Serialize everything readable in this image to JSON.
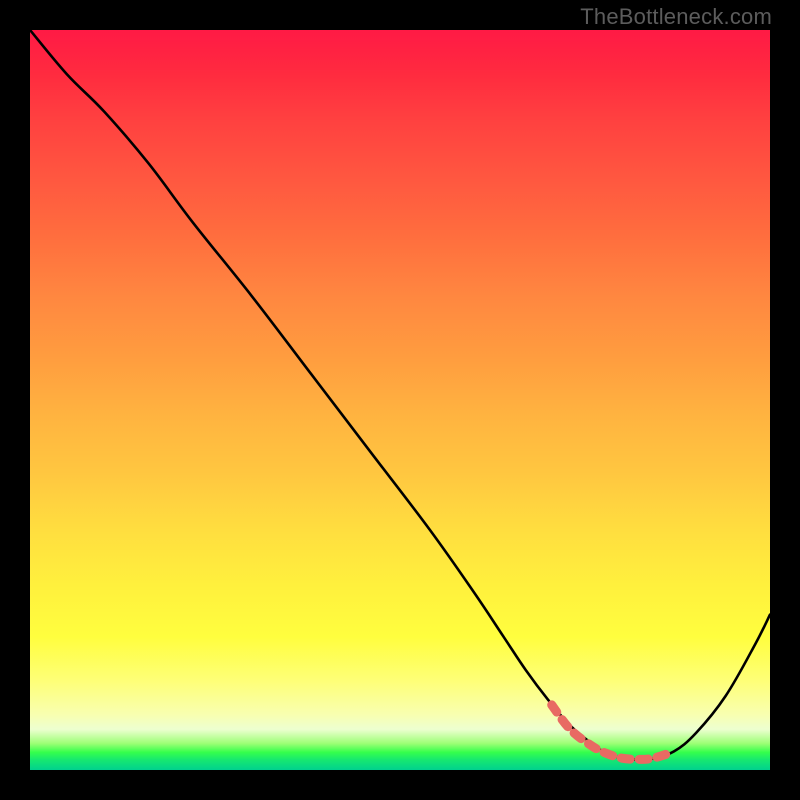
{
  "watermark": "TheBottleneck.com",
  "chart_data": {
    "type": "line",
    "title": "",
    "xlabel": "",
    "ylabel": "",
    "xlim": [
      0,
      100
    ],
    "ylim": [
      0,
      100
    ],
    "series": [
      {
        "name": "curve",
        "color": "#000000",
        "x": [
          0,
          5,
          10,
          16,
          22,
          30,
          38,
          46,
          54,
          60,
          64,
          67,
          70,
          73,
          76,
          78,
          80,
          82,
          84,
          87,
          90,
          94,
          98,
          100
        ],
        "y": [
          100,
          94,
          89,
          82,
          74,
          64,
          53.5,
          43,
          32.5,
          24,
          18,
          13.5,
          9.5,
          6,
          3.5,
          2.2,
          1.6,
          1.4,
          1.5,
          2.5,
          5,
          10,
          17,
          21
        ]
      },
      {
        "name": "bottom-highlight",
        "color": "#e86a63",
        "x": [
          70.5,
          73,
          76,
          78,
          80,
          82,
          84,
          86.5
        ],
        "y": [
          8.8,
          5.5,
          3.2,
          2.2,
          1.6,
          1.45,
          1.55,
          2.3
        ]
      }
    ],
    "gradient_zones": [
      {
        "pct": 0,
        "color": "#ff1a45"
      },
      {
        "pct": 20,
        "color": "#ff5740"
      },
      {
        "pct": 40,
        "color": "#ff9c3f"
      },
      {
        "pct": 60,
        "color": "#ffc740"
      },
      {
        "pct": 80,
        "color": "#fffe3e"
      },
      {
        "pct": 92,
        "color": "#f8ffb0"
      },
      {
        "pct": 96,
        "color": "#9dff76"
      },
      {
        "pct": 100,
        "color": "#00d18f"
      }
    ]
  }
}
